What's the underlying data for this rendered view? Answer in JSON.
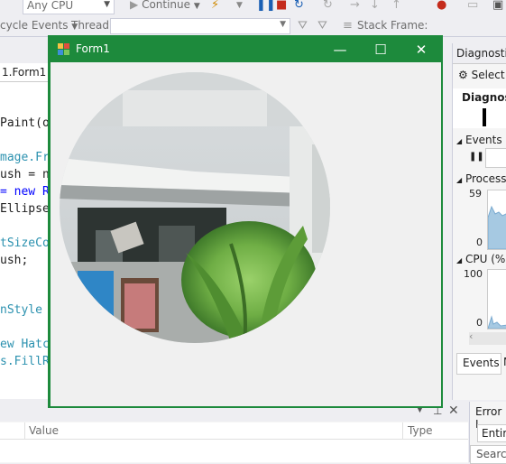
{
  "toolbar1": {
    "platform": "Any CPU",
    "continue_label": "Continue"
  },
  "toolbar2": {
    "lifecycle_label": "cycle Events",
    "thread_label": "Thread:",
    "stack_frame_label": "Stack Frame:"
  },
  "editor": {
    "tab_label": "1.Form1",
    "lines": [
      {
        "text": "Paint(o",
        "color": "#1e1e1e"
      },
      {
        "text": "mage.Fr",
        "color": "#2b91af"
      },
      {
        "text": "ush = n",
        "color": "#1e1e1e"
      },
      {
        "text": "= new R",
        "color": "#0000ff"
      },
      {
        "text": "Ellipse",
        "color": "#1e1e1e"
      },
      {
        "text": "tSizeCo",
        "color": "#2b91af"
      },
      {
        "text": "ush;",
        "color": "#1e1e1e"
      },
      {
        "text": "nStyle ",
        "color": "#2b91af"
      },
      {
        "text": "ew Hatc",
        "color": "#2b91af"
      },
      {
        "text": "s.FillR",
        "color": "#2b91af"
      }
    ]
  },
  "bottom_panel": {
    "col_value": "Value",
    "col_type": "Type"
  },
  "diagnostics": {
    "title": "Diagnosti",
    "select_label": "Select",
    "diagnostic_label": "Diagnost",
    "events_label": "Events",
    "process_label": "Process",
    "process_max": "59",
    "process_min": "0",
    "cpu_label": "CPU (%",
    "cpu_max": "100",
    "cpu_min": "0",
    "tab_events": "Events",
    "tab_m": "M"
  },
  "error_list": {
    "title": "Error L",
    "scope": "Entire",
    "search": "Search"
  },
  "form": {
    "title": "Form1",
    "minimize_icon": "minimize",
    "maximize_icon": "maximize",
    "close_icon": "close"
  }
}
